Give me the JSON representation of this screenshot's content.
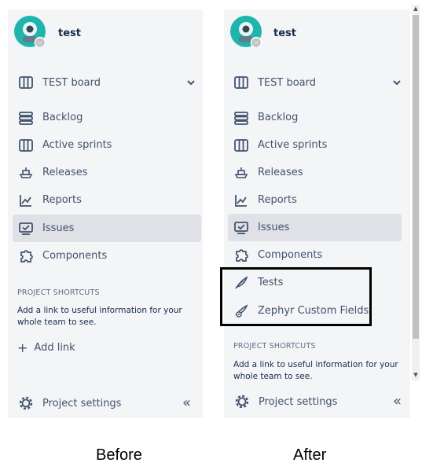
{
  "before": {
    "project_name": "test",
    "board_label": "TEST board",
    "nav": [
      {
        "label": "Backlog"
      },
      {
        "label": "Active sprints"
      },
      {
        "label": "Releases"
      },
      {
        "label": "Reports"
      },
      {
        "label": "Issues"
      },
      {
        "label": "Components"
      }
    ],
    "shortcuts_title": "PROJECT SHORTCUTS",
    "shortcuts_hint": "Add a link to useful information for your whole team to see.",
    "add_link_label": "Add link",
    "settings_label": "Project settings",
    "caption": "Before"
  },
  "after": {
    "project_name": "test",
    "board_label": "TEST board",
    "nav": [
      {
        "label": "Backlog"
      },
      {
        "label": "Active sprints"
      },
      {
        "label": "Releases"
      },
      {
        "label": "Reports"
      },
      {
        "label": "Issues"
      },
      {
        "label": "Components"
      },
      {
        "label": "Tests"
      },
      {
        "label": "Zephyr Custom Fields"
      }
    ],
    "shortcuts_title": "PROJECT SHORTCUTS",
    "shortcuts_hint": "Add a link to useful information for your whole team to see.",
    "settings_label": "Project settings",
    "caption": "After"
  },
  "colors": {
    "active_bg": "#dfe1e6",
    "panel_bg": "#f4f5f7",
    "text": "#42526e",
    "avatar": "#1fb5ad"
  }
}
